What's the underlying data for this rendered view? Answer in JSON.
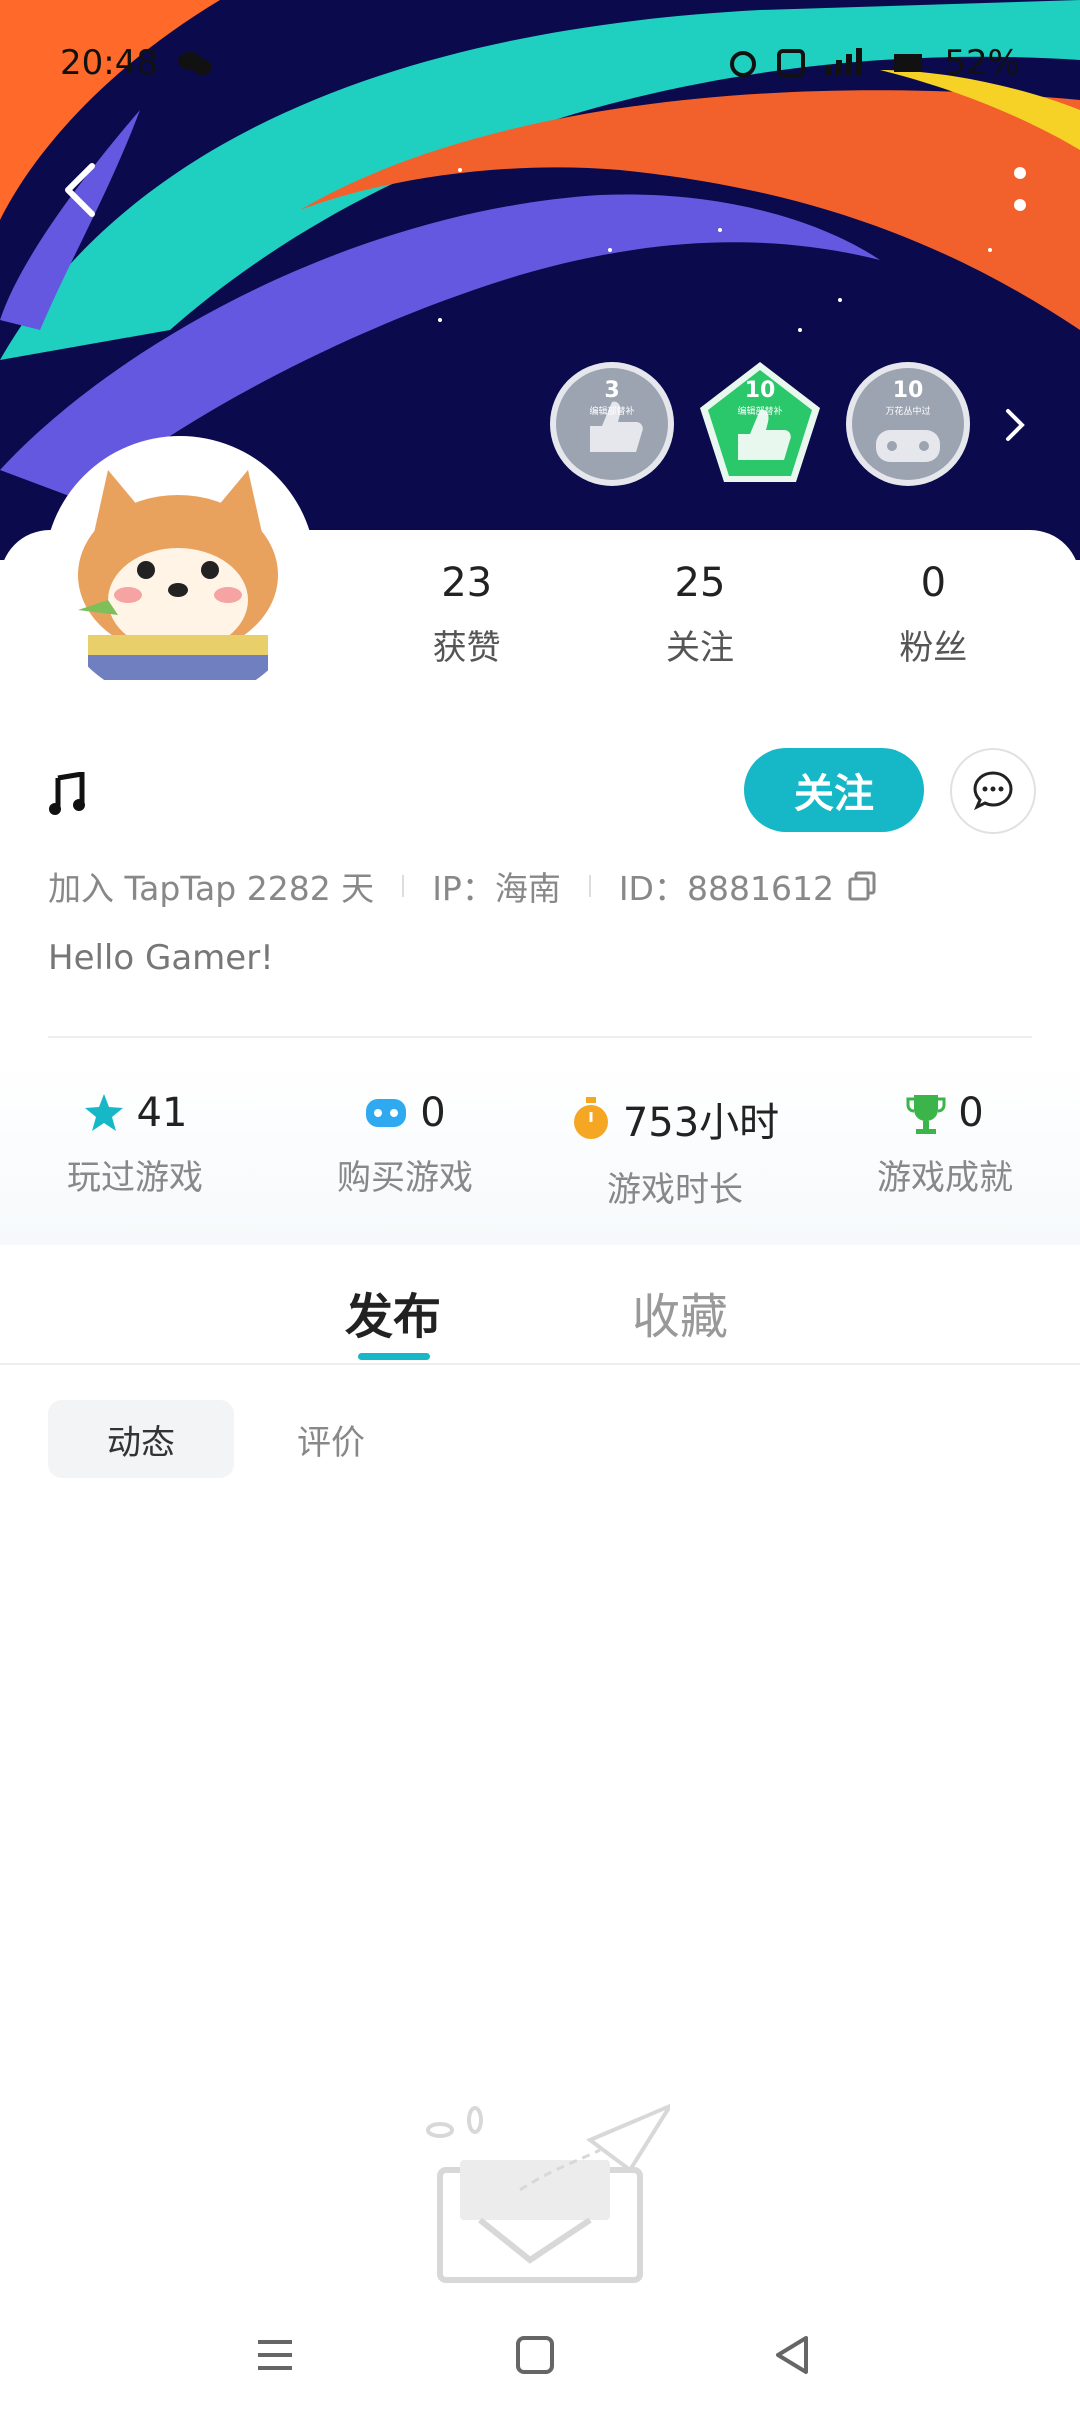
{
  "status_bar": {
    "time": "20:48",
    "battery": "52%"
  },
  "badges": [
    {
      "num": "3",
      "label": "编辑部替补"
    },
    {
      "num": "10",
      "label": "编辑部替补"
    },
    {
      "num": "10",
      "label": "万花丛中过"
    }
  ],
  "stats": [
    {
      "value": "23",
      "label": "获赞"
    },
    {
      "value": "25",
      "label": "关注"
    },
    {
      "value": "0",
      "label": "粉丝"
    }
  ],
  "follow_label": "关注",
  "info": {
    "join": "加入 TapTap 2282 天",
    "ip": "IP：海南",
    "id": "ID：8881612"
  },
  "bio": "Hello Gamer!",
  "game_stats": [
    {
      "value": "41",
      "label": "玩过游戏",
      "icon": "star-icon",
      "color": "#16b7c6"
    },
    {
      "value": "0",
      "label": "购买游戏",
      "icon": "gamepad-icon",
      "color": "#2fa9f0"
    },
    {
      "value": "753小时",
      "label": "游戏时长",
      "icon": "stopwatch-icon",
      "color": "#f5a623"
    },
    {
      "value": "0",
      "label": "游戏成就",
      "icon": "trophy-icon",
      "color": "#3bb54a"
    }
  ],
  "tabs": {
    "active": "发布",
    "inactive": "收藏"
  },
  "chips": {
    "active": "动态",
    "inactive": "评价"
  },
  "colors": {
    "accent": "#16b7c6",
    "banner_bg": "#0a0a4a"
  }
}
